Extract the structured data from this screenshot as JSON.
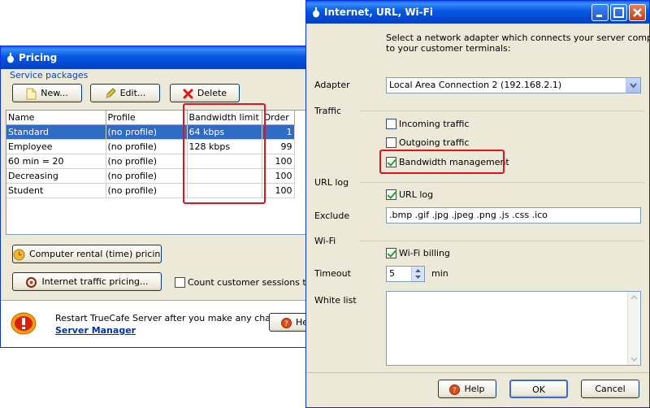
{
  "pricing": {
    "title": "Pricing",
    "group_label": "Service packages",
    "new_button": "New...",
    "edit_button": "Edit...",
    "delete_button": "Delete",
    "columns": [
      "Name",
      "Profile",
      "Bandwidth limit",
      "Order"
    ],
    "rows": [
      {
        "name": "Standard",
        "profile": "(no profile)",
        "bw": "64 kbps",
        "order": "1",
        "selected": true
      },
      {
        "name": "Employee",
        "profile": "(no profile)",
        "bw": "128 kbps",
        "order": "99"
      },
      {
        "name": "60 min = 20",
        "profile": "(no profile)",
        "bw": "",
        "order": "100"
      },
      {
        "name": "Decreasing",
        "profile": "(no profile)",
        "bw": "",
        "order": "100"
      },
      {
        "name": "Student",
        "profile": "(no profile)",
        "bw": "",
        "order": "100"
      }
    ],
    "computer_rental_button": "Computer rental (time) pricing...",
    "internet_traffic_button": "Internet traffic pricing...",
    "count_sessions_label": "Count customer sessions traffi",
    "restart_message": "Restart TrueCafe Server after you make any changes.",
    "server_manager_link": "Server Manager",
    "help_partial": "He"
  },
  "dialog": {
    "title": "Internet, URL, Wi-Fi",
    "description_line1": "Select a network adapter which connects your server computer",
    "description_line2": "to your customer terminals:",
    "adapter_label": "Adapter",
    "adapter_value": "Local Area Connection 2 (192.168.2.1)",
    "traffic_section": "Traffic",
    "incoming_traffic": "Incoming traffic",
    "outgoing_traffic": "Outgoing traffic",
    "bandwidth_management": "Bandwidth management",
    "url_log_section": "URL log",
    "url_log_checkbox": "URL log",
    "exclude_label": "Exclude",
    "exclude_value": ".bmp .gif .jpg .jpeg .png .js .css .ico",
    "wifi_section": "Wi-Fi",
    "wifi_billing": "Wi-Fi billing",
    "timeout_label": "Timeout",
    "timeout_value": "5",
    "timeout_unit": "min",
    "white_list_label": "White list",
    "help_button": "Help",
    "ok_button": "OK",
    "cancel_button": "Cancel"
  },
  "colors": {
    "highlight": "#e0141e",
    "selection": "#316ac5",
    "titlebar": "#0458e0"
  }
}
